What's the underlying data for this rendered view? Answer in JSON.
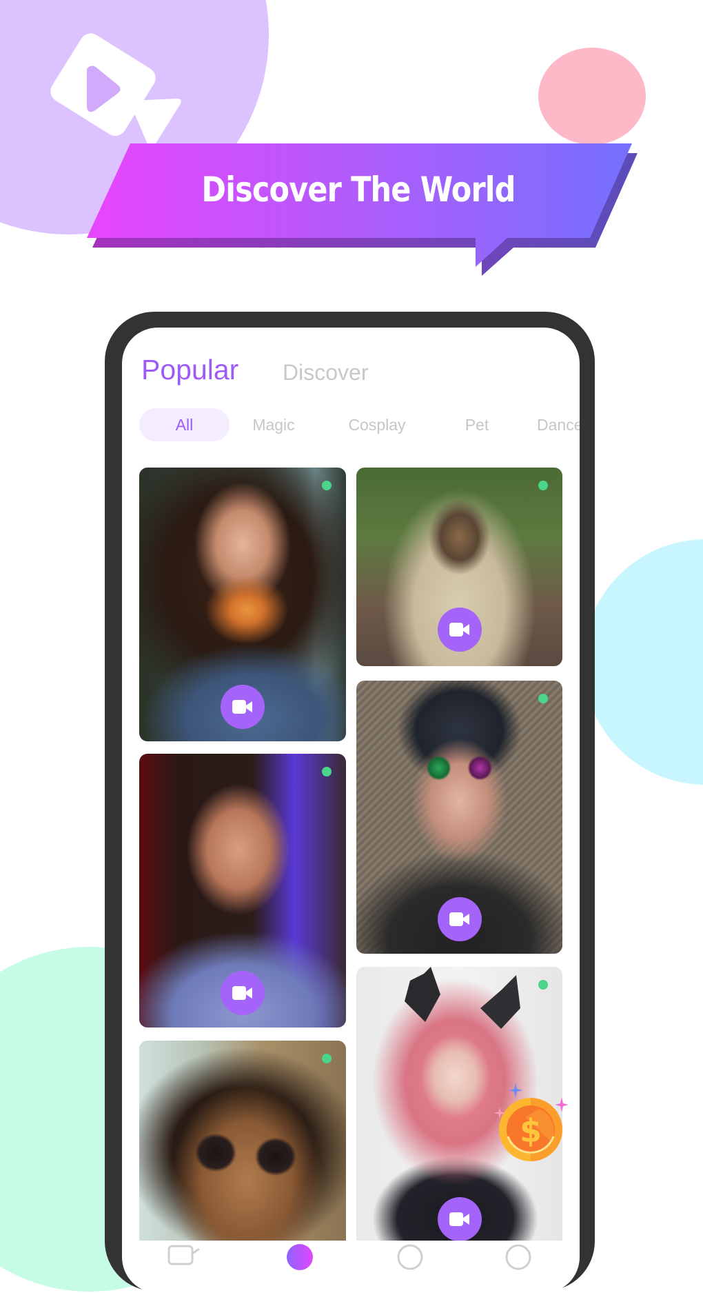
{
  "banner": {
    "title": "Discover The World"
  },
  "colors": {
    "accent": "#9d5cf5",
    "banner_gradient_start": "#e845fe",
    "banner_gradient_end": "#7570fd",
    "online_dot": "#4ad58a",
    "video_button": "#a464f9",
    "chip_active_bg": "#f4ecff",
    "inactive_text": "#c8c8c8"
  },
  "app": {
    "tabs": [
      {
        "label": "Popular",
        "active": true
      },
      {
        "label": "Discover",
        "active": false
      }
    ],
    "categories": [
      {
        "label": "All",
        "active": true
      },
      {
        "label": "Magic",
        "active": false
      },
      {
        "label": "Cosplay",
        "active": false
      },
      {
        "label": "Pet",
        "active": false
      },
      {
        "label": "Dance",
        "active": false
      }
    ],
    "feed": [
      {
        "subject": "woman-with-flowers",
        "online": true,
        "action_icon": "video-camera-icon"
      },
      {
        "subject": "pug-in-blanket",
        "online": true,
        "action_icon": "video-camera-icon"
      },
      {
        "subject": "bearded-man",
        "online": true,
        "action_icon": "video-camera-icon"
      },
      {
        "subject": "steampunk-woman",
        "online": true,
        "action_icon": "video-camera-icon"
      },
      {
        "subject": "woman-with-sunglasses",
        "online": true,
        "action_icon": "video-camera-icon"
      },
      {
        "subject": "pink-hair-cosplay",
        "online": true,
        "action_icon": "video-camera-icon",
        "badge_icon": "gold-coin-icon"
      }
    ],
    "bottom_nav": [
      {
        "icon": "video-camera-outline-icon",
        "active": false
      },
      {
        "icon": "gradient-circle-icon",
        "active": true
      },
      {
        "icon": "chat-circle-icon",
        "active": false
      },
      {
        "icon": "profile-circle-icon",
        "active": false
      }
    ]
  }
}
